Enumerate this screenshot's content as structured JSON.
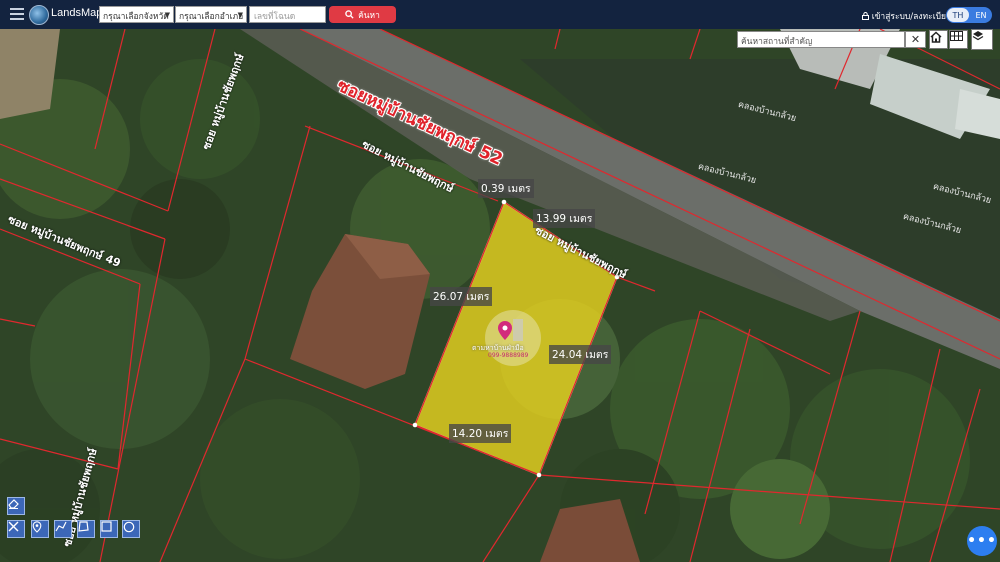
{
  "header": {
    "brand": "LandsMaps",
    "province_select": "กรุณาเลือกจังหวัด",
    "district_select": "กรุณาเลือกอำเภอ",
    "deed_placeholder": "เลขที่โฉนด",
    "search_label": "ค้นหา",
    "login_label": "เข้าสู่ระบบ/ลงทะเบียน",
    "lang_th": "TH",
    "lang_en": "EN"
  },
  "map_controls": {
    "place_search_placeholder": "ค้นหาสถานที่สำคัญ",
    "clear_label": "✕"
  },
  "roads": {
    "main_road": "ซอยหมู่บ้านชัยพฤกษ์ 52",
    "upper_left": "ซอย หมู่บ้านชัยพฤกษ์",
    "mid_label": "ซอย หมู่บ้านชัยพฤกษ์",
    "left_road": "ซอย หมู่บ้านชัยพฤกษ์ 49",
    "vertical_left": "ซอย หมู่บ้านชัยพฤกษ์",
    "along_plot": "ซอย หมู่บ้านชัยพฤกษ์",
    "canal_1": "คลองบ้านกล้วย",
    "canal_2": "คลองบ้านกล้วย",
    "canal_3": "คลองบ้านกล้วย",
    "canal_4": "คลองบ้านกล้วย"
  },
  "plot": {
    "top_edge": "0.39 เมตร",
    "road_edge": "13.99 เมตร",
    "left_edge": "26.07 เมตร",
    "right_edge": "24.04 เมตร",
    "bottom_edge": "14.20 เมตร",
    "fill_color": "#e6d21e",
    "boundary_color": "#e0282e",
    "watermark_line1": "ตามหาบ้านฝ่ามือ",
    "watermark_line2": "099-9888989"
  },
  "colors": {
    "topbar": "#13233f",
    "accent_red": "#e03a44",
    "accent_blue": "#3a7be0",
    "tool_blue": "#3c67b8"
  }
}
